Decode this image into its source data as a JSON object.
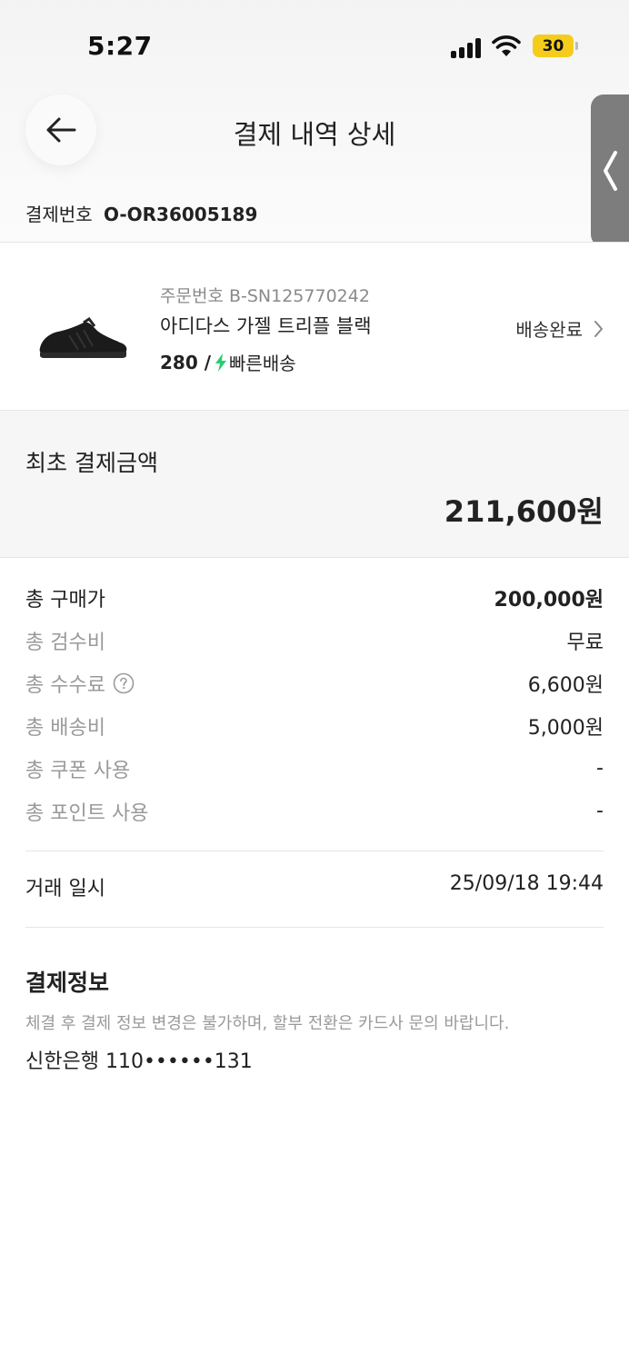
{
  "status_bar": {
    "time": "5:27",
    "battery": "30",
    "battery_color": "#f5cc1c"
  },
  "header": {
    "title": "결제 내역 상세",
    "back_icon": "arrow-left-icon",
    "side_icon": "chevron-left-icon"
  },
  "payment_number": {
    "label": "결제번호",
    "value": "O-OR36005189"
  },
  "product": {
    "order_number": "주문번호 B-SN125770242",
    "name": "아디다스 가젤 트리플 블랙",
    "size": "280 /",
    "delivery_type": "빠른배송",
    "delivery_icon": "lightning-icon",
    "delivery_icon_color": "#2bcc6c",
    "status": "배송완료"
  },
  "initial_payment": {
    "label": "최초 결제금액",
    "amount": "211,600원"
  },
  "breakdown": [
    {
      "label": "총 구매가",
      "value": "200,000원"
    },
    {
      "label": "총 검수비",
      "value": "무료"
    },
    {
      "label": "총 수수료",
      "value": "6,600원"
    },
    {
      "label": "총 배송비",
      "value": "5,000원"
    },
    {
      "label": "총 쿠폰 사용",
      "value": "-"
    },
    {
      "label": "총 포인트 사용",
      "value": "-"
    }
  ],
  "trade": {
    "label": "거래 일시",
    "value": "25/09/18 19:44"
  },
  "payment_info": {
    "title": "결제정보",
    "note": "체결 후 결제 정보 변경은 불가하며, 할부 전환은 카드사 문의 바랍니다.",
    "card": "신한은행 110••••••131"
  }
}
